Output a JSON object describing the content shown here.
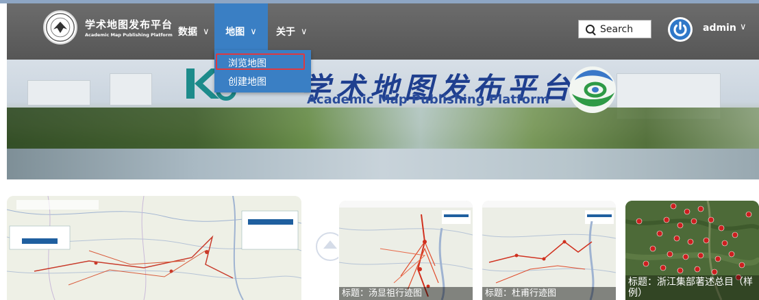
{
  "brand": {
    "title": "学术地图发布平台",
    "subtitle": "Academic Map Publishing Platform",
    "logo_icon": "university-seal-icon"
  },
  "nav": {
    "items": [
      {
        "label": "数据",
        "icon": "chevron-down-icon",
        "active": false
      },
      {
        "label": "地图",
        "icon": "chevron-down-icon",
        "active": true
      },
      {
        "label": "关于",
        "icon": "chevron-down-icon",
        "active": false
      }
    ],
    "map_menu": [
      {
        "label": "浏览地图",
        "highlighted": true
      },
      {
        "label": "创建地图",
        "highlighted": false
      }
    ]
  },
  "search": {
    "placeholder": "Search",
    "icon": "search-icon"
  },
  "user": {
    "name": "admin",
    "avatar_icon": "power-avatar-icon"
  },
  "banner": {
    "title": "学术地图发布平台",
    "subtitle": "Academic Map Publishing Platform"
  },
  "maps": [
    {
      "caption": "",
      "thumbnail": "itinerary-map-thumbnail"
    },
    {
      "caption": "标题：汤显祖行迹图",
      "thumbnail": "tang-xianzu-map-thumbnail"
    },
    {
      "caption": "标题：杜甫行迹图",
      "thumbnail": "du-fu-map-thumbnail"
    },
    {
      "caption": "标题：浙江集部著述总目（样例）",
      "thumbnail": "zhejiang-satellite-map-thumbnail"
    }
  ],
  "colors": {
    "navbar": "#616161",
    "active_nav": "#3a7fc4",
    "dropdown": "#3a7fc4",
    "highlight_border": "#e0383e",
    "avatar": "#2f78c8"
  }
}
